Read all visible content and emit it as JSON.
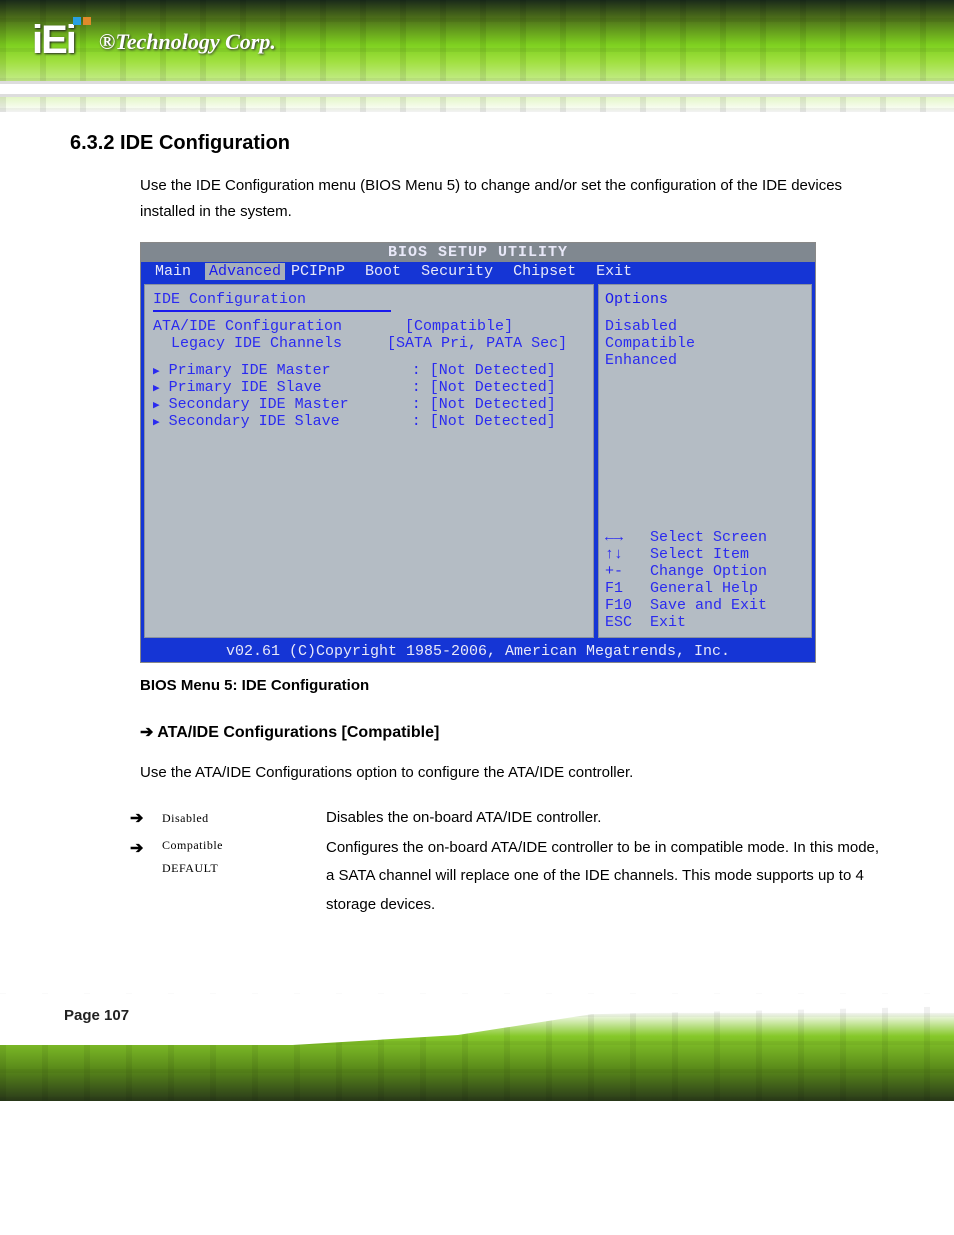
{
  "brand": {
    "logo_text": "iEi",
    "tagline": "®Technology Corp."
  },
  "section": {
    "number": "6.3.2 ",
    "title": "IDE Configuration"
  },
  "intro": "Use the IDE Configuration menu (BIOS Menu 5) to change and/or set the configuration of the IDE devices installed in the system.",
  "bios": {
    "title": "BIOS SETUP UTILITY",
    "tabs": [
      "Main",
      "Advanced",
      "PCIPnP",
      "Boot",
      "Security",
      "Chipset",
      "Exit"
    ],
    "active_tab": "Advanced",
    "panel_title": "IDE Configuration",
    "settings": [
      {
        "label": "ATA/IDE Configuration",
        "value": "[Compatible]"
      },
      {
        "label": "  Legacy IDE Channels",
        "value": "[SATA Pri, PATA Sec]"
      }
    ],
    "devices": [
      {
        "label": "Primary IDE Master",
        "value": ": [Not Detected]"
      },
      {
        "label": "Primary IDE Slave",
        "value": ": [Not Detected]"
      },
      {
        "label": "Secondary IDE Master",
        "value": ": [Not Detected]"
      },
      {
        "label": "Secondary IDE Slave",
        "value": ": [Not Detected]"
      }
    ],
    "options_title": "Options",
    "options": [
      "Disabled",
      "Compatible",
      "Enhanced"
    ],
    "help": [
      {
        "key": "←→",
        "label": "Select Screen"
      },
      {
        "key": "↑↓",
        "label": "Select Item"
      },
      {
        "key": "+-",
        "label": "Change Option"
      },
      {
        "key": "F1",
        "label": "General Help"
      },
      {
        "key": "F10",
        "label": "Save and Exit"
      },
      {
        "key": "ESC",
        "label": "Exit"
      }
    ],
    "footer": "v02.61 (C)Copyright 1985-2006, American Megatrends, Inc."
  },
  "figure_caption": "BIOS Menu 5: IDE Configuration",
  "option_heading": "ATA/IDE Configurations [Compatible]",
  "option_desc": "Use the ATA/IDE Configurations option to configure the ATA/IDE controller.",
  "bullets": [
    {
      "label": "Disabled",
      "default": "",
      "desc": "Disables the on-board ATA/IDE controller."
    },
    {
      "label": "Compatible",
      "default": "DEFAULT",
      "desc": "Configures the on-board ATA/IDE controller to be in compatible mode. In this mode, a SATA channel will replace one of the IDE channels. This mode supports up to 4 storage devices."
    }
  ],
  "page_number": "Page 107"
}
